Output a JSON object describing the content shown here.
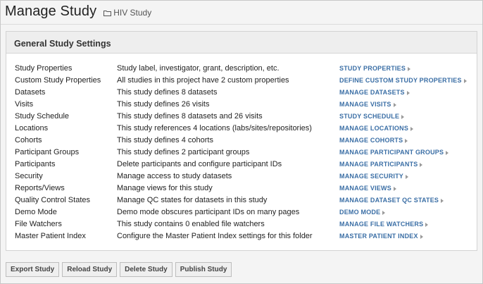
{
  "header": {
    "title": "Manage Study",
    "breadcrumb": "HIV Study"
  },
  "panel": {
    "title": "General Study Settings",
    "rows": [
      {
        "name": "Study Properties",
        "desc": "Study label, investigator, grant, description, etc.",
        "link": "STUDY PROPERTIES"
      },
      {
        "name": "Custom Study Properties",
        "desc": "All studies in this project have 2 custom properties",
        "link": "DEFINE CUSTOM STUDY PROPERTIES"
      },
      {
        "name": "Datasets",
        "desc": "This study defines 8 datasets",
        "link": "MANAGE DATASETS"
      },
      {
        "name": "Visits",
        "desc": "This study defines 26 visits",
        "link": "MANAGE VISITS"
      },
      {
        "name": "Study Schedule",
        "desc": "This study defines 8 datasets and 26 visits",
        "link": "STUDY SCHEDULE"
      },
      {
        "name": "Locations",
        "desc": "This study references 4 locations (labs/sites/repositories)",
        "link": "MANAGE LOCATIONS"
      },
      {
        "name": "Cohorts",
        "desc": "This study defines 4 cohorts",
        "link": "MANAGE COHORTS"
      },
      {
        "name": "Participant Groups",
        "desc": "This study defines 2 participant groups",
        "link": "MANAGE PARTICIPANT GROUPS"
      },
      {
        "name": "Participants",
        "desc": "Delete participants and configure participant IDs",
        "link": "MANAGE PARTICIPANTS"
      },
      {
        "name": "Security",
        "desc": "Manage access to study datasets",
        "link": "MANAGE SECURITY"
      },
      {
        "name": "Reports/Views",
        "desc": "Manage views for this study",
        "link": "MANAGE VIEWS"
      },
      {
        "name": "Quality Control States",
        "desc": "Manage QC states for datasets in this study",
        "link": "MANAGE DATASET QC STATES"
      },
      {
        "name": "Demo Mode",
        "desc": "Demo mode obscures participant IDs on many pages",
        "link": "DEMO MODE"
      },
      {
        "name": "File Watchers",
        "desc": "This study contains 0 enabled file watchers",
        "link": "MANAGE FILE WATCHERS"
      },
      {
        "name": "Master Patient Index",
        "desc": "Configure the Master Patient Index settings for this folder",
        "link": "MASTER PATIENT INDEX"
      }
    ]
  },
  "buttons": {
    "export": "Export Study",
    "reload": "Reload Study",
    "delete": "Delete Study",
    "publish": "Publish Study"
  },
  "icons": {
    "breadcrumb": "folder-icon",
    "link_arrow": "chevron-right-icon"
  },
  "colors": {
    "link": "#3a6ea5",
    "panel_header_bg": "#eeeeee",
    "page_bg": "#f4f4f4"
  }
}
